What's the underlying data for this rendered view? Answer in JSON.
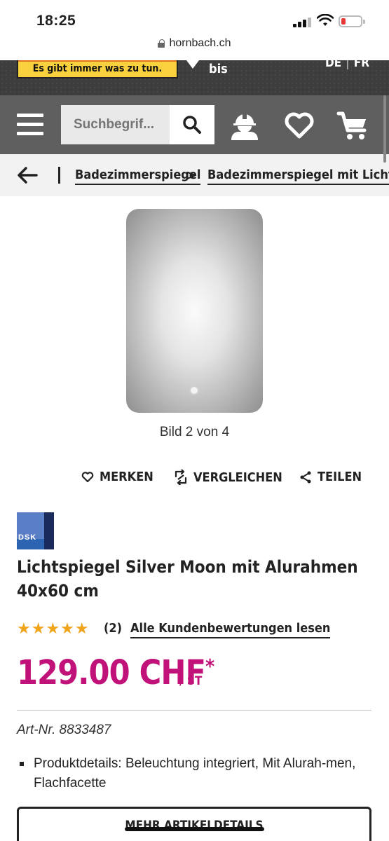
{
  "status_bar": {
    "time": "18:25"
  },
  "browser": {
    "url": "hornbach.ch"
  },
  "promo": {
    "slogan": "Es gibt immer was zu tun.",
    "text": "bis",
    "lang_de": "DE",
    "lang_fr": "FR"
  },
  "header": {
    "search_placeholder": "Suchbegrif...",
    "icons": [
      "menu-icon",
      "search-icon",
      "worker-icon",
      "heart-icon",
      "cart-icon"
    ]
  },
  "breadcrumb": {
    "items": [
      "Badezimmerspiegel",
      "Badezimmerspiegel mit Licht"
    ]
  },
  "gallery": {
    "caption": "Bild 2 von 4"
  },
  "actions": {
    "save": "MERKEN",
    "compare": "VERGLEICHEN",
    "share": "TEILEN"
  },
  "product": {
    "brand_logo_text": "DSK",
    "title": "Lichtspiegel Silver Moon mit Alurahmen 40x60 cm",
    "rating_stars": 5,
    "rating_count": "(2)",
    "reviews_link": "Alle Kundenbewertungen lesen",
    "price": "129.00 CHF",
    "price_mark": "*",
    "unit": "/ ST",
    "art_nr": "Art-Nr. 8833487",
    "details": "Produktdetails: Beleuchtung integriert, Mit Alurah-men, Flachfacette",
    "more_button": "MEHR ARTIKELDETAILS"
  },
  "colors": {
    "header_bg": "#5f5f5f",
    "price": "#c1127a",
    "star": "#f0a41c",
    "promo_yellow": "#f9d13e"
  }
}
